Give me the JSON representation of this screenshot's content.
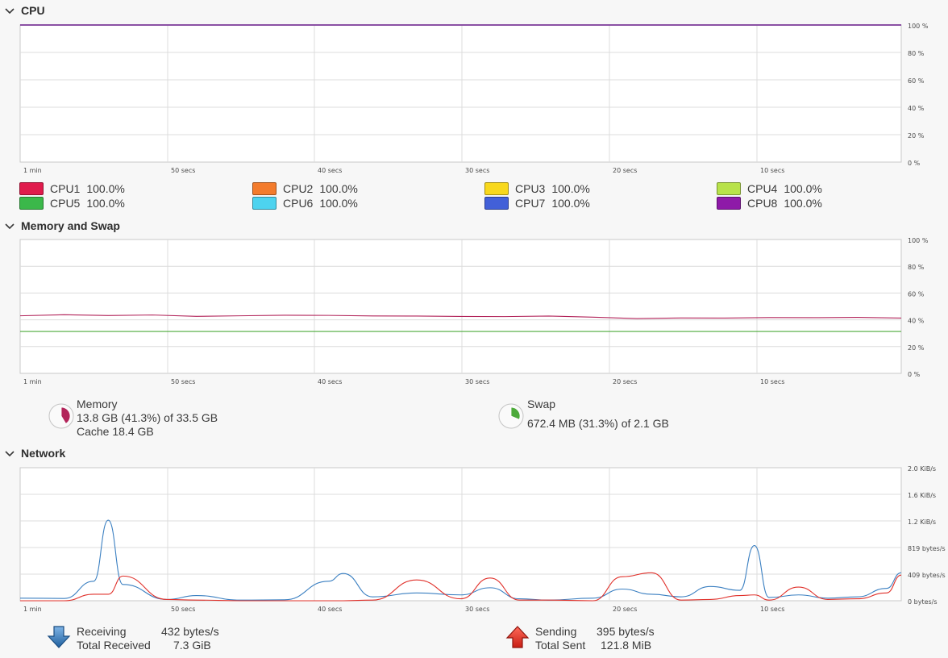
{
  "sections": {
    "cpu": {
      "title": "CPU"
    },
    "memory": {
      "title": "Memory and Swap"
    },
    "network": {
      "title": "Network"
    }
  },
  "time_ticks": [
    "1 min",
    "50 secs",
    "40 secs",
    "30 secs",
    "20 secs",
    "10 secs"
  ],
  "cpu": {
    "y_ticks": [
      "100 %",
      "80 %",
      "60 %",
      "40 %",
      "20 %",
      "0 %"
    ],
    "legend": [
      {
        "label": "CPU1",
        "value": "100.0%",
        "color": "#e01b4c"
      },
      {
        "label": "CPU2",
        "value": "100.0%",
        "color": "#f37b2c"
      },
      {
        "label": "CPU3",
        "value": "100.0%",
        "color": "#f8d81c"
      },
      {
        "label": "CPU4",
        "value": "100.0%",
        "color": "#b8e24a"
      },
      {
        "label": "CPU5",
        "value": "100.0%",
        "color": "#3bb84a"
      },
      {
        "label": "CPU6",
        "value": "100.0%",
        "color": "#4dd3ef"
      },
      {
        "label": "CPU7",
        "value": "100.0%",
        "color": "#4260d8"
      },
      {
        "label": "CPU8",
        "value": "100.0%",
        "color": "#8e1aa8"
      }
    ]
  },
  "memory": {
    "y_ticks": [
      "100 %",
      "80 %",
      "60 %",
      "40 %",
      "20 %",
      "0 %"
    ],
    "memory_label": "Memory",
    "memory_usage": "13.8 GB (41.3%) of 33.5 GB",
    "memory_cache": "Cache 18.4 GB",
    "memory_fraction": 0.413,
    "memory_color": "#b2245a",
    "swap_label": "Swap",
    "swap_usage": "672.4 MB (31.3%) of 2.1 GB",
    "swap_fraction": 0.313,
    "swap_color": "#4caa3a"
  },
  "network": {
    "y_ticks": [
      "2.0 KiB/s",
      "1.6 KiB/s",
      "1.2 KiB/s",
      "819 bytes/s",
      "409 bytes/s",
      "0 bytes/s"
    ],
    "receiving_label": "Receiving",
    "receiving_rate": "432 bytes/s",
    "total_received_label": "Total Received",
    "total_received": "7.3 GiB",
    "sending_label": "Sending",
    "sending_rate": "395 bytes/s",
    "total_sent_label": "Total Sent",
    "total_sent": "121.8 MiB",
    "receiving_color": "#3a7fc1",
    "sending_color": "#e0302a"
  },
  "chart_data": [
    {
      "type": "line",
      "x": [
        60,
        50,
        40,
        30,
        20,
        10,
        0
      ],
      "ylim": [
        0,
        100
      ],
      "series": [
        {
          "name": "CPU1",
          "values": [
            100,
            100,
            100,
            100,
            100,
            100,
            100
          ]
        },
        {
          "name": "CPU2",
          "values": [
            100,
            100,
            100,
            100,
            100,
            100,
            100
          ]
        },
        {
          "name": "CPU3",
          "values": [
            100,
            100,
            100,
            100,
            100,
            100,
            100
          ]
        },
        {
          "name": "CPU4",
          "values": [
            100,
            100,
            100,
            100,
            100,
            100,
            100
          ]
        },
        {
          "name": "CPU5",
          "values": [
            100,
            100,
            100,
            100,
            100,
            100,
            100
          ]
        },
        {
          "name": "CPU6",
          "values": [
            100,
            100,
            100,
            100,
            100,
            100,
            100
          ]
        },
        {
          "name": "CPU7",
          "values": [
            100,
            100,
            100,
            100,
            100,
            100,
            100
          ]
        },
        {
          "name": "CPU8",
          "values": [
            100,
            100,
            100,
            100,
            100,
            100,
            100
          ]
        }
      ]
    },
    {
      "type": "line",
      "x": [
        60,
        57,
        54,
        51,
        48,
        45,
        42,
        39,
        36,
        33,
        30,
        27,
        24,
        21,
        18,
        15,
        12,
        9,
        6,
        3,
        0
      ],
      "ylim": [
        0,
        100
      ],
      "series": [
        {
          "name": "Memory",
          "values": [
            43.0,
            43.8,
            43.2,
            43.6,
            42.6,
            43.0,
            43.4,
            43.3,
            42.9,
            42.8,
            42.5,
            42.4,
            42.8,
            42.0,
            40.9,
            41.4,
            41.3,
            41.7,
            41.6,
            41.8,
            41.3
          ]
        },
        {
          "name": "Swap",
          "values": [
            31.3,
            31.3,
            31.3,
            31.3,
            31.3,
            31.3,
            31.3,
            31.3,
            31.3,
            31.3,
            31.3,
            31.3,
            31.3,
            31.3,
            31.3,
            31.3,
            31.3,
            31.3,
            31.3,
            31.3,
            31.3
          ]
        }
      ]
    },
    {
      "type": "line",
      "x": [
        60,
        57,
        55,
        54,
        53,
        50,
        48,
        45,
        42,
        39,
        38,
        36,
        33,
        30,
        28,
        26,
        24,
        21,
        19,
        17,
        15,
        13,
        11,
        10,
        9,
        7,
        5,
        3,
        1,
        0
      ],
      "ylim": [
        0,
        2048
      ],
      "series": [
        {
          "name": "Receiving",
          "values": [
            40,
            35,
            300,
            1240,
            250,
            20,
            80,
            10,
            15,
            300,
            420,
            60,
            120,
            90,
            200,
            30,
            10,
            40,
            180,
            100,
            60,
            220,
            160,
            850,
            50,
            90,
            40,
            60,
            190,
            432
          ]
        },
        {
          "name": "Sending",
          "values": [
            0,
            0,
            100,
            100,
            380,
            20,
            10,
            0,
            0,
            0,
            0,
            10,
            320,
            30,
            350,
            10,
            10,
            0,
            370,
            430,
            10,
            20,
            80,
            90,
            10,
            210,
            20,
            30,
            120,
            395
          ]
        }
      ]
    }
  ]
}
